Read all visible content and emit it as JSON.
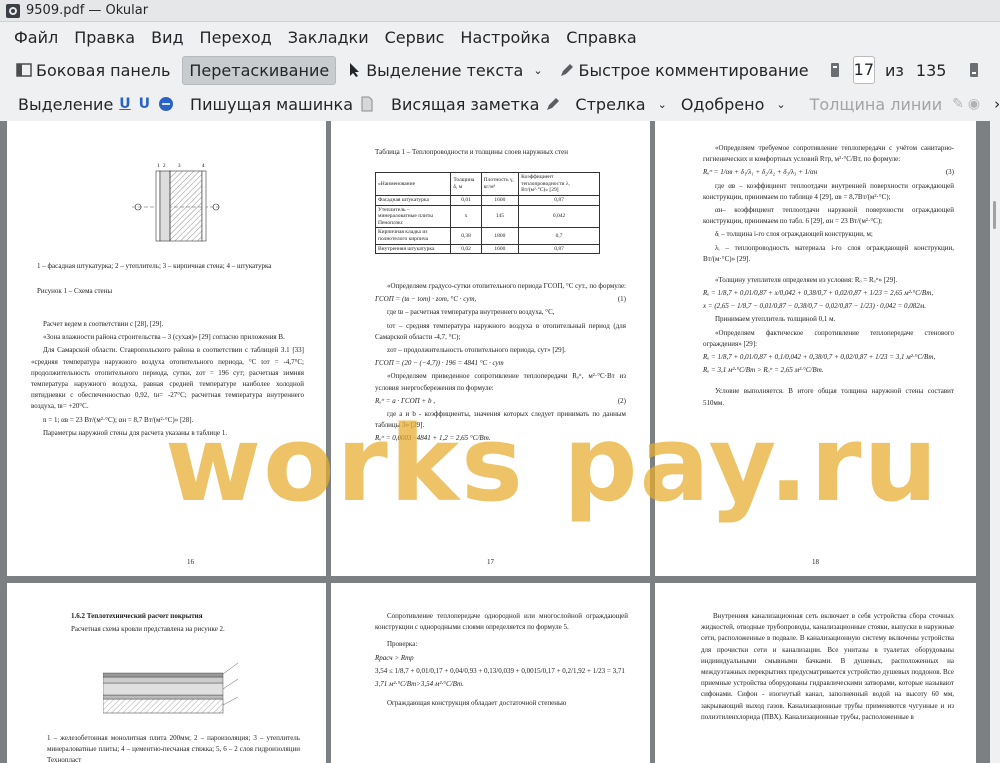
{
  "window": {
    "title": "9509.pdf — Okular"
  },
  "menu": [
    "Файл",
    "Правка",
    "Вид",
    "Переход",
    "Закладки",
    "Сервис",
    "Настройка",
    "Справка"
  ],
  "toolbar1": {
    "sidebar": "Боковая панель",
    "drag": "Перетаскивание",
    "text_select": "Выделение текста",
    "quick_comment": "Быстрое комментирование",
    "page_current": "17",
    "page_of": "из",
    "page_total": "135"
  },
  "toolbar2": {
    "highlight": "Выделение",
    "typewriter": "Пишущая машинка",
    "sticky": "Висящая заметка",
    "arrow": "Стрелка",
    "approved": "Одобрено",
    "line_width": "Толщина линии"
  },
  "watermark": "works pay.ru",
  "pages": {
    "p16": {
      "fig_caption": "1 – фасадная штукатурка; 2 – утеплитель; 3 – кирпичная стена; 4 – штукатурка",
      "fig_title": "Рисунок 1 – Схема стены",
      "p1": "Расчет ведем в соответствии с [28], [29].",
      "p2": "«Зона влажности района строительства – 3 (сухая)» [29] согласно приложения В.",
      "p3": "Для Самарской области. Ставропольского района в соответствии с таблицей 3.1 [33] «средняя температура наружного воздуха отопительного периода, °С tот = -4,7°С; продолжительность отопительного периода, сутки, zот = 196 сут; расчетная зимняя температура наружного воздуха, равная средней температуре наиболее холодной пятидневки с обеспеченностью 0,92, tн= -27°С; расчетная температура внутреннего воздуха, tв= +20°С.",
      "p4": "n = 1; αв = 23 Вт/(м²·°С); αн = 8,7 Вт/(м²·°С)» [28].",
      "p5": "Параметры наружной стены для расчета указаны в таблице 1.",
      "num": "16"
    },
    "p17": {
      "table_title": "Таблица 1 – Теплопроводности и толщины слоев наружных стен",
      "table_head": [
        "«Наименование",
        "Толщина δ, м",
        "Плотность γ, кг/м³",
        "Коэффициент теплопроводности λ, Вт/(м²·°С)» [29]"
      ],
      "table_rows": [
        [
          "Фасадная штукатурка",
          "0,01",
          "1600",
          "0,87"
        ],
        [
          "Утеплитель – минераловатные плиты Пеноплэкс",
          "x",
          "145",
          "0,042"
        ],
        [
          "Кирпичная кладка из полнотелого кирпича",
          "0,38",
          "1800",
          "0,7"
        ],
        [
          "Внутренняя штукатурка",
          "0,02",
          "1600",
          "0,87"
        ]
      ],
      "p1": "«Определяем градусо-сутки отопительного периода ГСОП, °С сут., по формуле:",
      "f1": "ГСОП = (tв − tот) · zот, °С · сут,",
      "f1n": "(1)",
      "p2": "где tв – расчетная температура внутреннего воздуха, °С,",
      "p3": "tот – средняя температура наружного воздуха в отопительный период (для Самарской области -4,7, °С);",
      "p4": "zот – продолжительность отопительного периода, сут» [29].",
      "f2": "ГСОП = (20 − (−4,7)) · 196 = 4841 °С · сут",
      "p5": "«Определяем приведенное сопротивление теплопередачи Rₒᵗʳ, м²·°С·Вт из условия энергосбережения по формуле:",
      "f3": "Rₒᵗʳ = a · ГСОП + b ,",
      "f3n": "(2)",
      "p6": "где a и b - коэффициенты, значения которых следует принимать по данным таблицы 3» [29].",
      "f4": "Rₒᵗʳ = 0,0003 · 4841 + 1,2 = 2,65 °С/Вт.",
      "num": "17"
    },
    "p18": {
      "p1": "«Определяем требуемое сопротивление теплопередачи с учётом санитарно- гигиенических и комфортных условий Rтр, м²·°С/Вт, по формуле:",
      "f1": "Rₒᵗʳ = 1/αв + δ₁/λ₁ + δ₂/λ₂ + δ₃/λ₃ + 1/αн",
      "f1n": "(3)",
      "p2": "где αв – коэффициент теплоотдачи внутренней поверхности ограждающей конструкции, принимаем по таблице 4 [29], αв = 8,7Вт/(м²·°С);",
      "p3": "αн– коэффициент теплоотдачи наружной поверхности ограждающей конструкции, принимаем по табл. 6 [29], αн = 23 Вт/(м²·°С);",
      "p4": "δᵢ – толщина i-го слоя ограждающей конструкции, м;",
      "p5": "λᵢ – теплопроводность материала i-го слоя ограждающей конструкции, Вт/(м·°С)» [29].",
      "p6": "«Толщину утеплителя определяем из условия: Rₒ = Rₒᵗʳ» [29].",
      "f2": "Rₒ = 1/8,7 + 0,01/0,87 + x/0,042 + 0,38/0,7 + 0,02/0,87 + 1/23 = 2,65 м²·°С/Вт,",
      "f3": "x = (2,65 − 1/8,7 − 0,01/0,87 − 0,38/0,7 − 0,02/0,87 − 1/23) · 0,042 = 0,082м.",
      "p7": "Принимаем утеплитель толщиной 0,1 м.",
      "p8": "«Определяем фактическое сопротивление теплопередаче стенового ограждения» [29]:",
      "f4": "Rₒ = 1/8,7 + 0,01/0,87 + 0,1/0,042 + 0,38/0,7 + 0,02/0,87 + 1/23 = 3,1 м²·°С/Вт,",
      "f5": "Rₒ = 3,1 м²·°С/Вт > Rₒᵗʳ = 2,65 м²·°С/Вт.",
      "p9": "Условие выполняется. В итоге общая толщина наружной стены составит 510мм.",
      "num": "18"
    },
    "p19": {
      "heading": "1.6.2 Теплотехнический расчет покрытия",
      "p1": "Расчетная схема кровли представлена на рисунке 2.",
      "fig_caption": "1 – железобетонная монолитная плита 200мм; 2 – пароизоляция; 3 – утеплитель минераловатные плиты; 4 – цементно-песчаная стяжка; 5, 6 – 2 слоя гидроизоляции Технопласт"
    },
    "p20": {
      "p1": "Сопротивление теплопередаче однородной или многослойной ограждающей конструкции с однородными слоями определяется по формуле 5.",
      "p2": "Проверка:",
      "f1": "Rрасч > Rтр",
      "f2": "3,54 ≤ 1/8,7 + 0,01/0,17 + 0,04/0,93 + 0,13/0,039 + 0,0015/0,17 + 0,2/1,92 + 1/23 = 3,71",
      "f3": "3,71 м²·°С/Вт>3,54 м²·°С/Вт.",
      "p3": "Ограждающая конструкция обладает достаточной степенью"
    },
    "p21": {
      "p1": "Внутренняя канализационная сеть включает в себя устройства сбора сточных жидкостей, отводные трубопроводы, канализационные стояки, выпуски в наружные сети, расположенные в подвале. В канализационную систему включены устройства для прочистки сети и канализации. Все унитазы в туалетах оборудованы индивидуальными смывными бачками. В душевых, расположенных на междуэтажных перекрытиях предусматривается устройство душевых поддонов. Все приемные устройства оборудованы гидравлическими затворами, которые называют сифонами. Сифон - изогнутый канал, заполненный водой на высоту 60 мм, закрывающий выход газов. Канализационные трубы применяются чугунные и из полиэтиленхлорида (ПВХ). Канализационные трубы, расположенные в"
    }
  }
}
